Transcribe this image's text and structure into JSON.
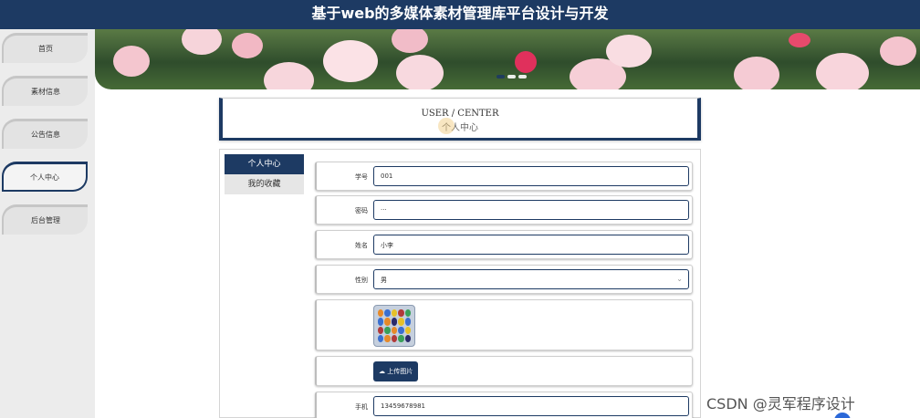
{
  "app": {
    "title": "基于web的多媒体素材管理库平台设计与开发"
  },
  "sidebar": {
    "items": [
      {
        "label": "首页",
        "active": false
      },
      {
        "label": "素材信息",
        "active": false
      },
      {
        "label": "公告信息",
        "active": false
      },
      {
        "label": "个人中心",
        "active": true
      },
      {
        "label": "后台管理",
        "active": false
      }
    ]
  },
  "banner": {
    "slide_count": 3,
    "active_slide": 1
  },
  "section": {
    "title_en": "USER / CENTER",
    "title_zh": "个人中心"
  },
  "tabs": [
    {
      "label": "个人中心",
      "active": true
    },
    {
      "label": "我的收藏",
      "active": false
    }
  ],
  "form": {
    "student_id": {
      "label": "学号",
      "value": "001"
    },
    "password": {
      "label": "密码",
      "value": "···"
    },
    "name": {
      "label": "姓名",
      "value": "小李"
    },
    "gender": {
      "label": "性别",
      "value": "男"
    },
    "avatar": {
      "icon": "app-grid-avatar"
    },
    "upload": {
      "label": "上传图片",
      "icon": "cloud-upload-icon"
    },
    "phone": {
      "label": "手机",
      "value": "13459678981"
    }
  },
  "watermark": {
    "text": "CSDN @灵军程序设计"
  },
  "colors": {
    "primary": "#1d3a63",
    "sidebar_bg": "#ececec"
  }
}
